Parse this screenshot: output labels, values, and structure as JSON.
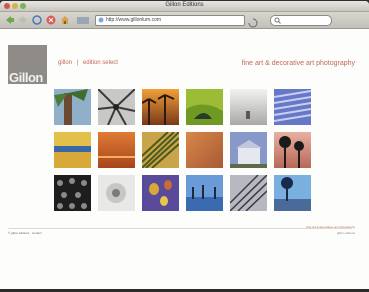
{
  "window": {
    "title": "Gillon Editions"
  },
  "toolbar": {
    "url": "http://www.gillonlum.com",
    "search_placeholder": ""
  },
  "header": {
    "logo_text": "Gillon",
    "nav": [
      "gillon",
      "|",
      "edition select"
    ],
    "tagline": "fine art & decorative art photography"
  },
  "gallery": {
    "thumbnails": [
      {
        "name": "palm-tree-closeup"
      },
      {
        "name": "palm-bw"
      },
      {
        "name": "palm-sunset-orange"
      },
      {
        "name": "green-hill-figure"
      },
      {
        "name": "grey-beach"
      },
      {
        "name": "blue-palm-fronds"
      },
      {
        "name": "sea-horizon-yellow"
      },
      {
        "name": "orange-sunset-sea"
      },
      {
        "name": "palm-leaf-gold"
      },
      {
        "name": "orange-sky"
      },
      {
        "name": "blue-house"
      },
      {
        "name": "palm-silhouette-pink"
      },
      {
        "name": "black-domes"
      },
      {
        "name": "white-flower"
      },
      {
        "name": "balloons-purple"
      },
      {
        "name": "palm-row-blue"
      },
      {
        "name": "bridge-cables"
      },
      {
        "name": "blue-silhouette-palms"
      }
    ]
  },
  "footer": {
    "left": "© gillon editions · contact",
    "right_top": "fine art & decorative art photography",
    "right_bottom": "gillon editions"
  },
  "colors": {
    "accent": "#c06a58",
    "logo_bg": "#8f8c88"
  }
}
